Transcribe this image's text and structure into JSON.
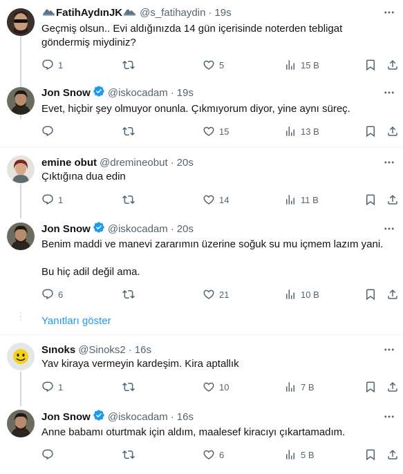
{
  "tweets": [
    {
      "name": "FatihAydınJK",
      "handle": "@s_fatihaydin",
      "dot": "·",
      "time": "19s",
      "text": "Geçmiş olsun.. Evi aldığınızda 14 gün içerisinde noterden tebligat göndermiş miydiniz?",
      "replies": "1",
      "likes": "5",
      "views": "15 B"
    },
    {
      "name": "Jon Snow",
      "handle": "@iskocadam",
      "dot": "·",
      "time": "19s",
      "text": "Evet, hiçbir şey olmuyor onunla. Çıkmıyorum diyor, yine aynı süreç.",
      "replies": "",
      "likes": "15",
      "views": "13 B"
    },
    {
      "name": "emine obut",
      "handle": "@dremineobut",
      "dot": "·",
      "time": "20s",
      "text": "Çıktığına dua edin",
      "replies": "1",
      "likes": "14",
      "views": "11 B"
    },
    {
      "name": "Jon Snow",
      "handle": "@iskocadam",
      "dot": "·",
      "time": "20s",
      "text_line1": "Benim maddi ve manevi zararımın üzerine soğuk su mu içmem lazım yani.",
      "text_line2": "Bu hiç adil değil ama.",
      "replies": "6",
      "likes": "21",
      "views": "10 B"
    },
    {
      "name": "Sınoks",
      "handle": "@Sinoks2",
      "dot": "·",
      "time": "16s",
      "text": "Yav kiraya vermeyin kardeşim. Kira aptallık",
      "replies": "1",
      "likes": "10",
      "views": "7 B"
    },
    {
      "name": "Jon Snow",
      "handle": "@iskocadam",
      "dot": "·",
      "time": "16s",
      "text": "Anne babamı oturtmak için aldım, maalesef kiracıyı çıkartamadım.",
      "replies": "",
      "likes": "6",
      "views": "5 B"
    }
  ],
  "show_replies_label": "Yanıtları göster",
  "colors": {
    "verified": "#1d9bf0",
    "link": "#1d9bf0",
    "muted": "#536471",
    "text": "#0f1419",
    "separator": "#eff3f4"
  },
  "icons": [
    "reply-icon",
    "retweet-icon",
    "like-icon",
    "views-icon",
    "bookmark-icon",
    "share-icon",
    "more-icon",
    "verified-badge-icon",
    "mountain-emoji-icon"
  ]
}
